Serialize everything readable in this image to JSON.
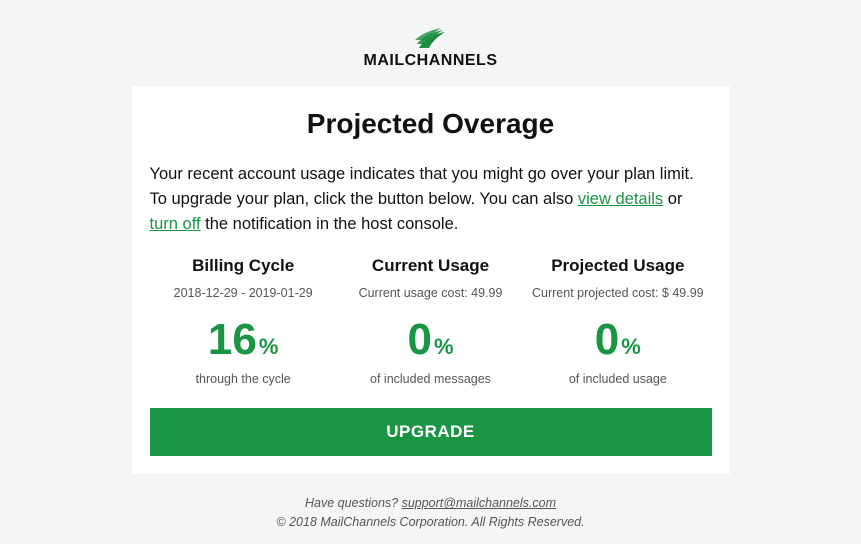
{
  "logo": {
    "text": "MAILCHANNELS"
  },
  "title": "Projected Overage",
  "intro": {
    "pre": "Your recent account usage indicates that you might go over your plan limit. To upgrade your plan, click the button below. You can also ",
    "link1": "view details",
    "mid": " or ",
    "link2": "turn off",
    "post": " the notification in the host console."
  },
  "stats": {
    "billing": {
      "title": "Billing Cycle",
      "sub": "2018-12-29 - 2019-01-29",
      "value": "16",
      "pct": "%",
      "caption": "through the cycle"
    },
    "current": {
      "title": "Current Usage",
      "sub": "Current usage cost: 49.99",
      "value": "0",
      "pct": "%",
      "caption": "of included messages"
    },
    "projected": {
      "title": "Projected Usage",
      "sub": "Current projected cost: $ 49.99",
      "value": "0",
      "pct": "%",
      "caption": "of included usage"
    }
  },
  "upgrade": "UPGRADE",
  "footer": {
    "question": "Have questions? ",
    "email": "support@mailchannels.com",
    "copyright": "© 2018 MailChannels Corporation. All Rights Reserved."
  }
}
